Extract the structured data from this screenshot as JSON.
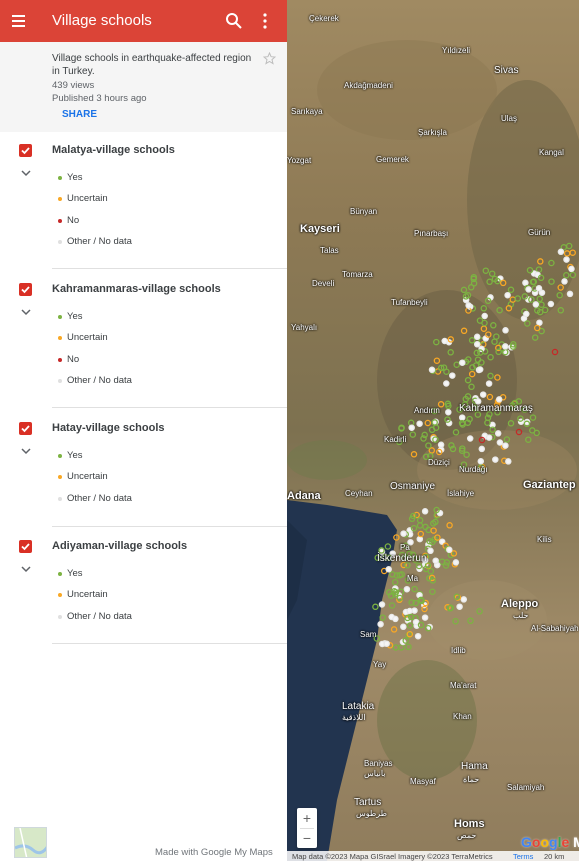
{
  "app": {
    "title": "Village schools"
  },
  "info": {
    "description": "Village schools in earthquake-affected region in Turkey.",
    "views": "439 views",
    "published": "Published 3 hours ago",
    "share_label": "SHARE"
  },
  "colors": {
    "header": "#db4437",
    "yes": "#7cb342",
    "uncertain": "#f9a825",
    "no": "#c62828",
    "other": "#e0e0e0",
    "checkbox": "#d93025"
  },
  "layers": [
    {
      "name": "Malatya-village schools",
      "items": [
        {
          "label": "Yes",
          "icon": "green-dot"
        },
        {
          "label": "Uncertain",
          "icon": "orange-dot"
        },
        {
          "label": "No",
          "icon": "red-dot"
        },
        {
          "label": "Other / No data",
          "icon": "white-dot"
        }
      ]
    },
    {
      "name": "Kahramanmaras-village schools",
      "items": [
        {
          "label": "Yes",
          "icon": "green-dot"
        },
        {
          "label": "Uncertain",
          "icon": "orange-dot"
        },
        {
          "label": "No",
          "icon": "red-dot"
        },
        {
          "label": "Other / No data",
          "icon": "white-dot"
        }
      ]
    },
    {
      "name": "Hatay-village schools",
      "items": [
        {
          "label": "Yes",
          "icon": "green-dot"
        },
        {
          "label": "Uncertain",
          "icon": "orange-dot"
        },
        {
          "label": "Other / No data",
          "icon": "white-dot"
        }
      ]
    },
    {
      "name": "Adiyaman-village schools",
      "items": [
        {
          "label": "Yes",
          "icon": "green-dot"
        },
        {
          "label": "Uncertain",
          "icon": "orange-dot"
        },
        {
          "label": "Other / No data",
          "icon": "white-dot"
        }
      ]
    }
  ],
  "footer": {
    "made_with": "Made with Google My Maps"
  },
  "map": {
    "places": {
      "cekerek": "Çekerek",
      "yildizeli": "Yıldızeli",
      "sivas": "Sivas",
      "akdagmadeni": "Akdağmadeni",
      "ulas": "Ulaş",
      "sarkisla": "Şarkışla",
      "sarikaya": "Sarıkaya",
      "gemerek": "Gemerek",
      "kangal": "Kangal",
      "yozgat": "Yozgat",
      "bunyan": "Bünyan",
      "kayseri": "Kayseri",
      "pinarbasi": "Pınarbaşı",
      "gurun": "Gürün",
      "talas": "Talas",
      "tomarza": "Tomarza",
      "develi": "Develi",
      "tufanbeyli": "Tufanbeyli",
      "yahyali": "Yahyalı",
      "andirin": "Andırın",
      "kahramanmaras": "Kahramanmaraş",
      "kadirli": "Kadirli",
      "duzici": "Düziçi",
      "nurdagi": "Nurdağı",
      "adana": "Adana",
      "osmaniye": "Osmaniye",
      "gaziantep": "Gaziantep",
      "ceyhan": "Ceyhan",
      "islahiye": "İslahiye",
      "iskenderun": "İskenderun",
      "kilis": "Kilis",
      "aleppo": "Aleppo",
      "aleppo_ar": "حلب",
      "albab": "Al-Sabahiyah",
      "idlib": "Idlib",
      "latakia": "Latakia",
      "latakia_ar": "اللاذقية",
      "majarat": "Ma'arat",
      "khan": "Khan",
      "baniyas": "Baniyas",
      "baniyas_ar": "بانياس",
      "masyaf": "Masyaf",
      "hama": "Hama",
      "hama_ar": "حماة",
      "salamiyah": "Salamiyah",
      "tartus": "Tartus",
      "tartus_ar": "طرطوس",
      "homs": "Homs",
      "homs_ar": "حمص",
      "sam": "Sam",
      "yay": "Yay",
      "pa": "Pa",
      "ma": "Ma"
    },
    "zoom_in": "+",
    "zoom_out": "−",
    "logo": "Google My",
    "attribution": "Map data ©2023 Mapa GISrael Imagery ©2023 TerraMetrics",
    "terms": "Terms",
    "scale": "20 km"
  }
}
